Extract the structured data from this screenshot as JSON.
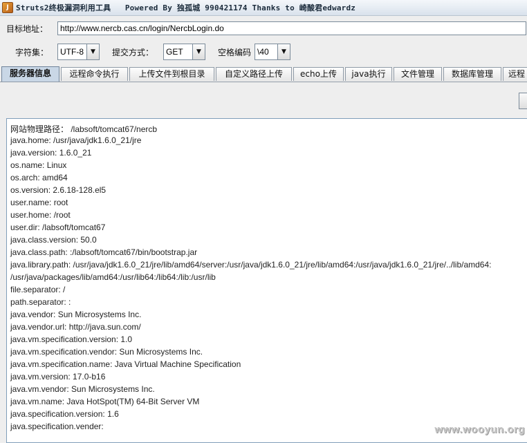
{
  "window": {
    "title": "Struts2终极漏洞利用工具   Powered By 独孤城 990421174 Thanks to 崎酸君edwardz"
  },
  "target": {
    "label": "目标地址：",
    "url": "http://www.nercb.cas.cn/login/NercbLogin.do"
  },
  "options": {
    "charset_label": "字符集：",
    "charset_value": "UTF-8",
    "method_label": "提交方式：",
    "method_value": "GET",
    "space_label": "空格编码",
    "space_value": "\\40"
  },
  "tabs": [
    {
      "label": "服务器信息",
      "active": true
    },
    {
      "label": "远程命令执行"
    },
    {
      "label": "上传文件到根目录"
    },
    {
      "label": "自定义路径上传"
    },
    {
      "label": "echo上传"
    },
    {
      "label": "java执行"
    },
    {
      "label": "文件管理"
    },
    {
      "label": "数据库管理"
    },
    {
      "label": "远程"
    }
  ],
  "output_lines": [
    "网站物理路径： /labsoft/tomcat67/nercb",
    "java.home: /usr/java/jdk1.6.0_21/jre",
    "java.version: 1.6.0_21",
    "os.name: Linux",
    "os.arch: amd64",
    "os.version: 2.6.18-128.el5",
    "user.name: root",
    "user.home: /root",
    "user.dir: /labsoft/tomcat67",
    "java.class.version: 50.0",
    "java.class.path: :/labsoft/tomcat67/bin/bootstrap.jar",
    "java.library.path: /usr/java/jdk1.6.0_21/jre/lib/amd64/server:/usr/java/jdk1.6.0_21/jre/lib/amd64:/usr/java/jdk1.6.0_21/jre/../lib/amd64:",
    "/usr/java/packages/lib/amd64:/usr/lib64:/lib64:/lib:/usr/lib",
    "file.separator: /",
    "path.separator: :",
    "java.vendor: Sun Microsystems Inc.",
    "java.vendor.url: http://java.sun.com/",
    "java.vm.specification.version: 1.0",
    "java.vm.specification.vendor: Sun Microsystems Inc.",
    "java.vm.specification.name: Java Virtual Machine Specification",
    "java.vm.version: 17.0-b16",
    "java.vm.vendor: Sun Microsystems Inc.",
    "java.vm.name: Java HotSpot(TM) 64-Bit Server VM",
    "java.specification.version: 1.6",
    "java.specification.vender:"
  ],
  "watermark": "www.wooyun.org",
  "icons": {
    "app": "java-coffee-icon",
    "dropdown": "chevron-down-icon"
  }
}
